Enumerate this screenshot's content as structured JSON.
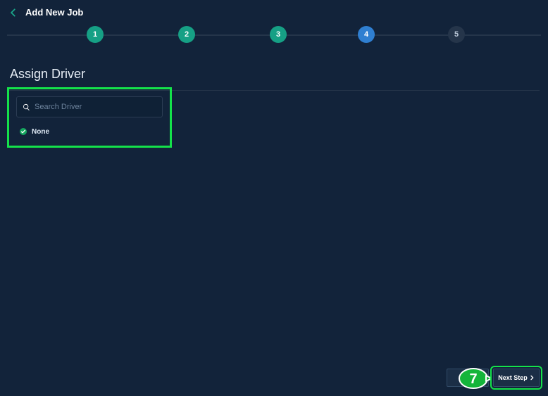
{
  "header": {
    "back_icon": "arrow-left",
    "title": "Add New Job"
  },
  "stepper": {
    "steps": [
      {
        "label": "1",
        "state": "done"
      },
      {
        "label": "2",
        "state": "done"
      },
      {
        "label": "3",
        "state": "done"
      },
      {
        "label": "4",
        "state": "current"
      },
      {
        "label": "5",
        "state": "upcoming"
      }
    ]
  },
  "section": {
    "title": "Assign Driver"
  },
  "search": {
    "placeholder": "Search Driver",
    "value": ""
  },
  "driver_options": {
    "none_label": "None",
    "none_selected": true
  },
  "actions": {
    "next_label": "Next Step"
  },
  "annotations": {
    "callout_number": "7",
    "highlight_color": "#14e24a"
  }
}
